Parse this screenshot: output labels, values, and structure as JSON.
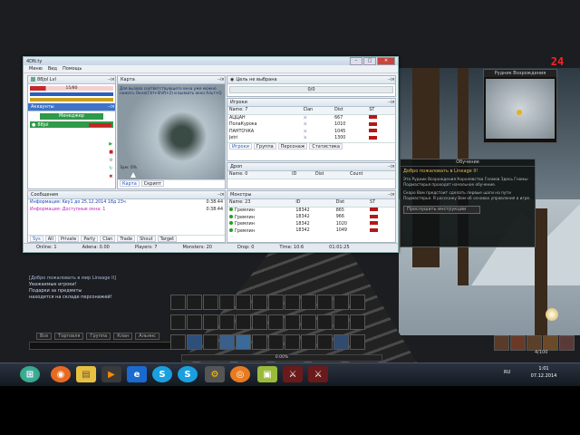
{
  "fps": "24",
  "minimap": {
    "title": "Рудник Возрождения"
  },
  "tutorial": {
    "title": "Обучение",
    "heading": "Добро пожаловать в Lineage II!",
    "para1": "Это Рудник Возрождения Королевства Гномов Здесь Гномы-Подмастерья проходят начальное обучение.",
    "para2": "Скоро Вам предстоит сделать первые шаги на пути Подмастерья. Я расскажу Вам об основах управления в игре.",
    "button": "Прослушать инструкции"
  },
  "game_chat": {
    "lines": [
      {
        "text": "[Добро пожаловать в мир Lineage II]",
        "color": "#a8b8d8"
      },
      {
        "text": "Уважаемые игроки!",
        "color": "#c8d8f0"
      },
      {
        "text": "Подарки за предметы",
        "color": "#c8d8f0"
      },
      {
        "text": "находятся на складе персонажей!",
        "color": "#c8d8f0"
      }
    ],
    "tabs": [
      "Все",
      "Торговля",
      "Группа",
      "Клан",
      "Альянс"
    ],
    "xp": "0.00%",
    "bag": "4/100"
  },
  "window": {
    "title": "4DN.ty",
    "menu": [
      "Меню",
      "Вид",
      "Помощь"
    ],
    "left_panel": {
      "char_name": "88jol",
      "char_level": "Lvl",
      "hp_text": "15/80",
      "accounts_header": "Аккаунты",
      "manager_label": "Менеджер",
      "account_row": "88jol"
    },
    "map_panel": {
      "title": "Карта",
      "text": "Для вызова соответствующего окна уже можно нажать Окна(Ctrl+Shift+2) и вызвать окно Альт+Q",
      "zoom_label": "Зум: 0%",
      "tabs": [
        "Карта",
        "Скрипт"
      ]
    },
    "target_panel": {
      "title": "Цель не выбрана",
      "value": "0/0"
    },
    "players_panel": {
      "header": "Игроки",
      "col_name": "Name: 7",
      "col_clan": "Clan",
      "col_dist": "Dist",
      "col_st": "ST",
      "rows": [
        {
          "name": "АЦЦАН",
          "dist": "667"
        },
        {
          "name": "ПолаКурока",
          "dist": "1010"
        },
        {
          "name": "ПАНТОЧКА",
          "dist": "1045"
        },
        {
          "name": "Jetri",
          "dist": "1300"
        }
      ],
      "tabs": [
        "Игроки",
        "Группа",
        "Персонаж",
        "Статистика"
      ]
    },
    "drops_panel": {
      "header": "Дроп",
      "col_name": "Name: 0",
      "col_id": "ID",
      "col_dist": "Dist",
      "col_count": "Count"
    },
    "monsters_panel": {
      "header": "Монстры",
      "col_name": "Name: 23",
      "col_id": "ID",
      "col_dist": "Dist",
      "col_st": "ST",
      "rows": [
        {
          "name": "Гремлин",
          "id": "18342",
          "dist": "865"
        },
        {
          "name": "Гремлин",
          "id": "18342",
          "dist": "966"
        },
        {
          "name": "Гремлин",
          "id": "18342",
          "dist": "1020"
        },
        {
          "name": "Гремлин",
          "id": "18342",
          "dist": "1049"
        }
      ]
    },
    "messages_panel": {
      "header": "Сообщения",
      "rows": [
        {
          "text": "Информация: Key1 до 25.12.2014 18д 23ч",
          "time": "0:38:44",
          "color": "#1a3fb0"
        },
        {
          "text": "Информация: Доступные окна: 1",
          "time": "0:38:44",
          "color": "#c020c0"
        }
      ],
      "tabs": [
        "Sys",
        "All",
        "Private",
        "Party",
        "Clan",
        "Trade",
        "Shout",
        "Target"
      ]
    },
    "status": {
      "online": "Online: 1",
      "adena": "Adena: 0.00",
      "players": "Players: 7",
      "monsters": "Monsters: 20",
      "drops": "Drop: 0",
      "time": "Time: 10:6",
      "clock": "01:01:25"
    }
  },
  "taskbar": {
    "lang": "RU",
    "time": "1:01",
    "date": "07.12.2014"
  }
}
